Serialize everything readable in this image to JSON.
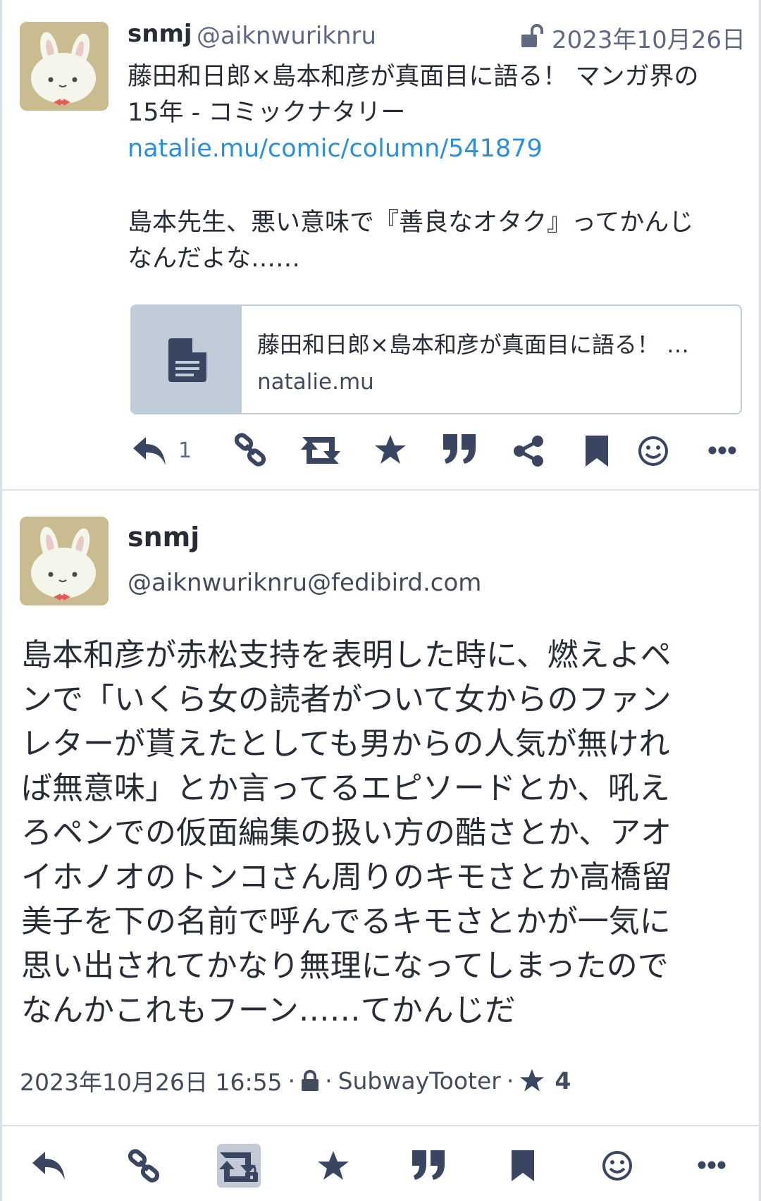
{
  "status1": {
    "display_name": "snmj",
    "acct": "@aiknwuriknru",
    "visibility_icon": "unlock-icon",
    "date": "2023年10月26日",
    "text_lines": [
      "藤田和日郎×島本和彦が真面目に語る！ マンガ界の",
      "15年 - コミックナタリー"
    ],
    "link": "natalie.mu/comic/column/541879",
    "text_lines2": [
      "島本先生、悪い意味で『善良なオタク』ってかんじ",
      "なんだよな……"
    ],
    "card": {
      "icon": "document-icon",
      "title": "藤田和日郎×島本和彦が真面目に語る！ …",
      "host": "natalie.mu"
    },
    "actions": {
      "reply_count": "1",
      "icons": [
        "reply-icon",
        "link-icon",
        "boost-icon",
        "favourite-icon",
        "quote-icon",
        "share-icon",
        "bookmark-icon",
        "emoji-reaction-icon",
        "more-icon"
      ]
    }
  },
  "status2": {
    "display_name": "snmj",
    "acct": "@aiknwuriknru@fedibird.com",
    "text_lines": [
      "島本和彦が赤松支持を表明した時に、燃えよペ",
      "ンで「いくら女の読者がついて女からのファン",
      "レターが貰えたとしても男からの人気が無けれ",
      "ば無意味」とか言ってるエピソードとか、吼え",
      "ろペンでの仮面編集の扱い方の酷さとか、アオ",
      "イホノオのトンコさん周りのキモさとか高橋留",
      "美子を下の名前で呼んでるキモさとかが一気に",
      "思い出されてかなり無理になってしまったので",
      "なんかこれもフーン……てかんじだ"
    ],
    "meta": {
      "datetime": "2023年10月26日 16:55",
      "separator": "·",
      "visibility_icon": "lock-icon",
      "client": "SubwayTooter",
      "favourite_icon": "star-icon",
      "favourite_count": "4"
    },
    "actions": {
      "icons": [
        "reply-icon",
        "link-icon",
        "boost-private-icon",
        "favourite-icon",
        "quote-icon",
        "bookmark-icon",
        "emoji-reaction-icon",
        "more-icon"
      ]
    }
  },
  "colors": {
    "text": "#282c37",
    "secondary": "#606984",
    "link": "#2b90d9",
    "icon": "#3a4561",
    "border": "#d9e1e8",
    "avatar_bg": "#c9bc91"
  }
}
